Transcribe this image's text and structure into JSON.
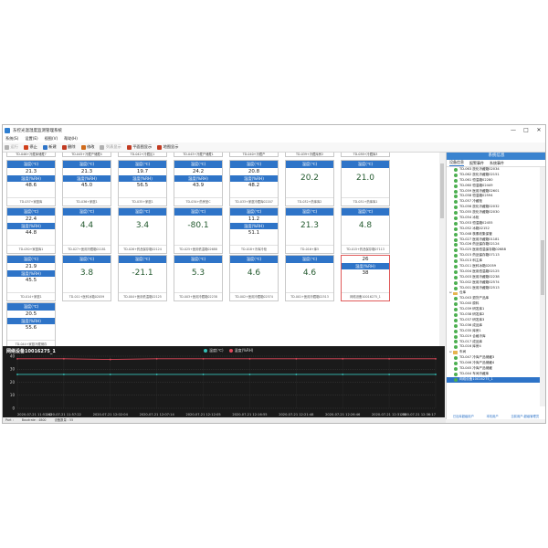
{
  "window": {
    "title": "东控光温湿度监测管理系统",
    "controls": [
      "—",
      "□",
      "✕"
    ]
  },
  "menu": [
    "系统(S)",
    "设置(E)",
    "视图(V)",
    "帮助(H)"
  ],
  "toolbar": [
    {
      "label": "运行",
      "color": "#b0b0b0",
      "disabled": true
    },
    {
      "label": "停止",
      "color": "#d0401b",
      "disabled": false
    },
    {
      "label": "新建",
      "color": "#2e74c8",
      "disabled": false
    },
    {
      "label": "删除",
      "color": "#c23b22",
      "disabled": false
    },
    {
      "label": "修改",
      "color": "#d06b1b",
      "disabled": false
    },
    {
      "label": "列表显示",
      "color": "#b0b0b0",
      "disabled": true
    },
    {
      "label": "平面图显示",
      "color": "#c23b22",
      "disabled": false
    },
    {
      "label": "地图显示",
      "color": "#c23b22",
      "disabled": false
    }
  ],
  "top_partial_labels": [
    "TD-046+冷藏库储藏7",
    "TD-045+冷藏产储藏4",
    "TD-042+冷藏区1",
    "TD-043+冷藏产储藏1",
    "TD-040+冷藏产",
    "TD-039+冷藏库房2",
    "TD-038+冷藏库3"
  ],
  "card_labels": {
    "temp": "温度(℃)",
    "hum": "湿度(%RH)"
  },
  "cards": [
    {
      "kind": "dual",
      "t": "21.3",
      "h": "48.6",
      "footer": "TD-037+家庭库"
    },
    {
      "kind": "dual",
      "t": "21.3",
      "h": "45.0",
      "footer": "TD-036+家庭1"
    },
    {
      "kind": "dual",
      "t": "19.7",
      "h": "56.5",
      "footer": "TD-035+家庭1"
    },
    {
      "kind": "dual",
      "t": "24.2",
      "h": "43.9",
      "footer": "TD-034+药房室C"
    },
    {
      "kind": "dual",
      "t": "20.8",
      "h": "48.2",
      "footer": "TD-033+家庭冷藏库02207"
    },
    {
      "kind": "single",
      "t": "20.2",
      "footer": "TD-032+药库库2"
    },
    {
      "kind": "single",
      "t": "21.0",
      "footer": "TD-031+药库库1"
    },
    {
      "kind": "dual",
      "t": "22.4",
      "h": "44.8",
      "footer": "TD-030+家庭库1"
    },
    {
      "kind": "single",
      "t": "4.4",
      "footer": "TD-027+医用冷藏箱01181"
    },
    {
      "kind": "single",
      "t": "3.4",
      "footer": "TD-026+药品保存箱02124"
    },
    {
      "kind": "single",
      "t": "-80.1",
      "footer": "TD-025+医用低温箱02688"
    },
    {
      "kind": "dual",
      "t": "11.2",
      "h": "51.1",
      "footer": "TD-018+冷库冷柜"
    },
    {
      "kind": "single",
      "t": "21.3",
      "footer": "TD-016+库5"
    },
    {
      "kind": "single",
      "t": "4.8",
      "footer": "TD-015+药品保存箱07113"
    },
    {
      "kind": "dual",
      "t": "21.9",
      "h": "45.5",
      "footer": "TD-014+家庭1"
    },
    {
      "kind": "single",
      "t": "3.8",
      "footer": "TD-011+医科冰箱02059"
    },
    {
      "kind": "single",
      "t": "-21.1",
      "footer": "TD-004+医用低温箱02125"
    },
    {
      "kind": "single",
      "t": "5.3",
      "footer": "TD-003+医用冷藏箱02238"
    },
    {
      "kind": "single",
      "t": "4.6",
      "footer": "TD-002+医用冷藏箱02574"
    },
    {
      "kind": "single",
      "t": "4.6",
      "footer": "TD-001+医用冷藏箱02513"
    },
    {
      "kind": "selected",
      "t": "26",
      "h": "38",
      "footer": "网络设备10016275_1"
    },
    {
      "kind": "dual",
      "t": "20.5",
      "h": "55.6",
      "footer": "TD-044+家庭冷藏储存"
    }
  ],
  "chart_data": {
    "type": "line",
    "title": "网络设备10016275_1",
    "ylim": [
      0,
      40
    ],
    "yticks": [
      "40",
      "30",
      "20",
      "10",
      "0"
    ],
    "x": [
      "2020-07-21 11:52:42",
      "2020-07-21 11:57:22",
      "2020-07-21 12:02:04",
      "2020-07-21 12:07:14",
      "2020-07-21 12:12:05",
      "2020-07-21 12:16:55",
      "2020-07-21 12:21:48",
      "2020-07-21 12:26:46",
      "2020-07-21 12:31:38",
      "2020-07-21 12:36:17"
    ],
    "series": [
      {
        "name": "温度(℃)",
        "color": "#35c1b8",
        "values": [
          26,
          26,
          26,
          26,
          26,
          26,
          26,
          26,
          26,
          26
        ]
      },
      {
        "name": "湿度(%RH)",
        "color": "#e0485a",
        "values": [
          38,
          38,
          37.5,
          38,
          38,
          38,
          38,
          38,
          38,
          38
        ]
      }
    ],
    "grid": true,
    "legend": "top-center"
  },
  "sidebar": {
    "header": "系统信息",
    "tabs": [
      "设备信息",
      "报警事件",
      "系统事件"
    ],
    "tree": [
      {
        "label": "TD-063 放化冷藏箱02034",
        "type": "dev"
      },
      {
        "label": "TD-062 放化冷藏箱02151",
        "type": "dev"
      },
      {
        "label": "TD-061 恒温箱02280",
        "type": "dev"
      },
      {
        "label": "TD-060 恒温箱02449",
        "type": "dev"
      },
      {
        "label": "TD-059 医用冷藏箱02601",
        "type": "dev"
      },
      {
        "label": "TD-058 恒温箱02594",
        "type": "dev"
      },
      {
        "label": "TD-057 冷藏柜",
        "type": "dev"
      },
      {
        "label": "TD-056 放化冷藏箱02032",
        "type": "dev"
      },
      {
        "label": "TD-055 放化冷藏箱02030",
        "type": "dev"
      },
      {
        "label": "TD-054 冰柜",
        "type": "dev"
      },
      {
        "label": "TD-053 恒温箱02455",
        "type": "dev"
      },
      {
        "label": "TD-052 冰箱02152",
        "type": "dev"
      },
      {
        "label": "TD-048 核素收集保管",
        "type": "dev"
      },
      {
        "label": "TD-027 医用冷藏箱01181",
        "type": "dev"
      },
      {
        "label": "TD-026 药品保存箱02124",
        "type": "dev"
      },
      {
        "label": "TD-025 医用低温保存箱02688",
        "type": "dev"
      },
      {
        "label": "TD-015 药品保存箱07113",
        "type": "dev"
      },
      {
        "label": "TD-013 科主库",
        "type": "dev"
      },
      {
        "label": "TD-011 医科冰箱02059",
        "type": "dev"
      },
      {
        "label": "TD-004 医用低温箱02125",
        "type": "dev"
      },
      {
        "label": "TD-003 医用冷藏箱02238",
        "type": "dev"
      },
      {
        "label": "TD-002 医用冷藏箱02574",
        "type": "dev"
      },
      {
        "label": "TD-001 医用冷藏箱02513",
        "type": "dev"
      },
      {
        "label": "仓库",
        "type": "folder"
      },
      {
        "label": "TD-043 退货产品库",
        "type": "dev"
      },
      {
        "label": "TD-040 原料",
        "type": "dev"
      },
      {
        "label": "TD-039 研发库1",
        "type": "dev"
      },
      {
        "label": "TD-038 研发库2",
        "type": "dev"
      },
      {
        "label": "TD-037 研发库3",
        "type": "dev"
      },
      {
        "label": "TD-036 成品库",
        "type": "dev"
      },
      {
        "label": "TD-035 库房1",
        "type": "dev"
      },
      {
        "label": "TD-019 合格冷库",
        "type": "dev"
      },
      {
        "label": "TD-017 成品库",
        "type": "dev"
      },
      {
        "label": "TD-016 库房4",
        "type": "dev"
      },
      {
        "label": "车间",
        "type": "folder"
      },
      {
        "label": "TD-047 冷库产品储藏3",
        "type": "dev"
      },
      {
        "label": "TD-046 冷库产品储藏4",
        "type": "dev"
      },
      {
        "label": "TD-045 冷库产品储藏",
        "type": "dev"
      },
      {
        "label": "TD-044 车间冷藏库",
        "type": "dev"
      },
      {
        "label": "网络设备10016275_1",
        "type": "selected"
      }
    ],
    "footer": [
      "已出库超级用户",
      "本机用户",
      "当前用户:超级管理员"
    ]
  },
  "statusbar": [
    "Port :",
    "Baudrate : 4800",
    "设备数量 : 55"
  ]
}
